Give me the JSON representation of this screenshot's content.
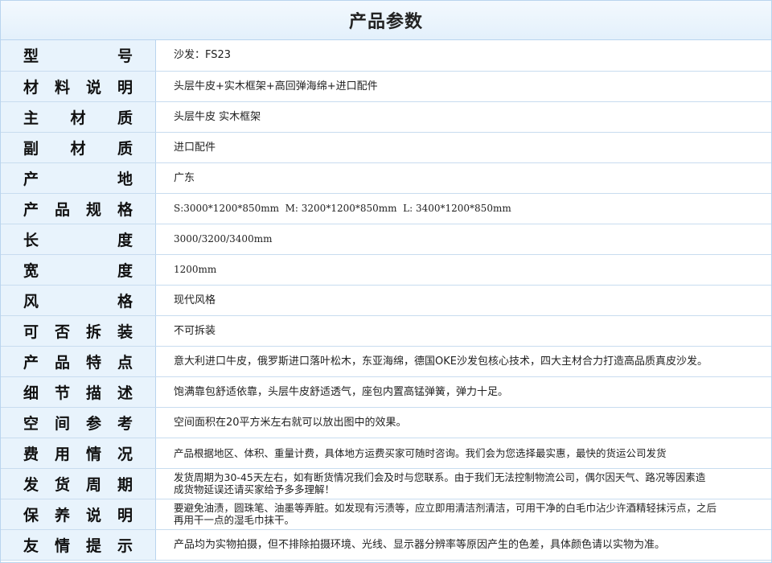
{
  "title": "产品参数",
  "rows": [
    {
      "label": "型号",
      "value": "沙发：FS23"
    },
    {
      "label": "材料说明",
      "value": "头层牛皮+实木框架+高回弹海绵+进口配件"
    },
    {
      "label": "主材质",
      "value": "头层牛皮 实木框架"
    },
    {
      "label": "副材质",
      "value": "进口配件"
    },
    {
      "label": "产地",
      "value": "广东"
    },
    {
      "label": "产品规格",
      "value": "S:3000*1200*850mm  M: 3200*1200*850mm  L: 3400*1200*850mm"
    },
    {
      "label": "长度",
      "value": "3000/3200/3400mm"
    },
    {
      "label": "宽度",
      "value": "1200mm"
    },
    {
      "label": "风格",
      "value": "现代风格"
    },
    {
      "label": "可否拆装",
      "value": "不可拆装"
    },
    {
      "label": "产品特点",
      "value": "意大利进口牛皮，俄罗斯进口落叶松木，东亚海绵，德国OKE沙发包核心技术，四大主材合力打造高品质真皮沙发。"
    },
    {
      "label": "细节描述",
      "value": "饱满靠包舒适依靠，头层牛皮舒适透气，座包内置高锰弹簧，弹力十足。"
    },
    {
      "label": "空间参考",
      "value": "空间面积在20平方米左右就可以放出图中的效果。"
    },
    {
      "label": "费用情况",
      "value": "产品根据地区、体积、重量计费，具体地方运费买家可随时咨询。我们会为您选择最实惠，最快的货运公司发货"
    },
    {
      "label": "发货周期",
      "value": "发货周期为30-45天左右，如有断货情况我们会及时与您联系。由于我们无法控制物流公司，偶尔因天气、路况等因素造成货物延误还请买家给予多多理解！"
    },
    {
      "label": "保养说明",
      "value": "要避免油渍，圆珠笔、油墨等弄脏。如发现有污渍等，应立即用清洁剂清洁，可用干净的白毛巾沾少许酒精轻抹污点，之后再用干一点的湿毛巾抹干。"
    },
    {
      "label": "友情提示",
      "value": "产品均为实物拍摄，但不排除拍摄环境、光线、显示器分辨率等原因产生的色差，具体颜色请以实物为准。"
    }
  ]
}
